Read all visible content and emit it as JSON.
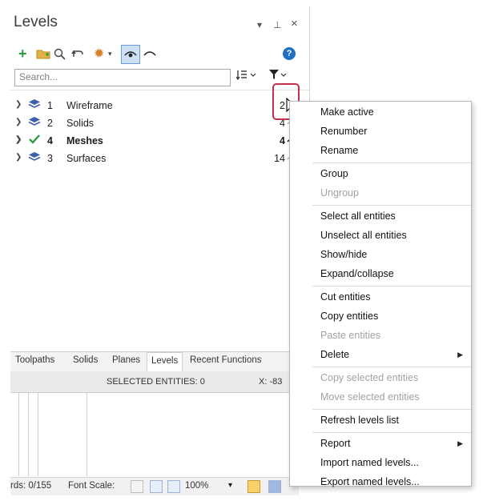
{
  "panel": {
    "title": "Levels",
    "controls": {
      "dropdown": "▾",
      "pin": "⊥",
      "close": "×"
    },
    "search_placeholder": "Search...",
    "help": "?"
  },
  "levels": [
    {
      "num": "1",
      "name": "Wireframe",
      "count": "2",
      "active": false,
      "color": "#3b5fa8"
    },
    {
      "num": "2",
      "name": "Solids",
      "count": "4",
      "active": false,
      "color": "#3b5fa8"
    },
    {
      "num": "4",
      "name": "Meshes",
      "count": "4",
      "active": true,
      "color": "#2d9b3e"
    },
    {
      "num": "3",
      "name": "Surfaces",
      "count": "14",
      "active": false,
      "color": "#3b5fa8"
    }
  ],
  "tabs": [
    "Toolpaths",
    "Solids",
    "Planes",
    "Levels",
    "Recent Functions"
  ],
  "status": {
    "selected": "SELECTED ENTITIES: 0",
    "x": "X:  -83"
  },
  "bottom": {
    "records": "rds: 0/155",
    "font_scale": "Font Scale:",
    "zoom": "100%"
  },
  "menu": [
    {
      "label": "Make active",
      "disabled": false
    },
    {
      "label": "Renumber",
      "disabled": false
    },
    {
      "label": "Rename",
      "disabled": false
    },
    {
      "sep": true
    },
    {
      "label": "Group",
      "disabled": false
    },
    {
      "label": "Ungroup",
      "disabled": true
    },
    {
      "sep": true
    },
    {
      "label": "Select all entities",
      "disabled": false
    },
    {
      "label": "Unselect all entities",
      "disabled": false
    },
    {
      "label": "Show/hide",
      "disabled": false
    },
    {
      "label": "Expand/collapse",
      "disabled": false
    },
    {
      "sep": true
    },
    {
      "label": "Cut entities",
      "disabled": false
    },
    {
      "label": "Copy entities",
      "disabled": false
    },
    {
      "label": "Paste entities",
      "disabled": true
    },
    {
      "label": "Delete",
      "disabled": false,
      "submenu": true
    },
    {
      "sep": true
    },
    {
      "label": "Copy selected entities",
      "disabled": true
    },
    {
      "label": "Move selected entities",
      "disabled": true
    },
    {
      "sep": true
    },
    {
      "label": "Refresh levels list",
      "disabled": false
    },
    {
      "sep": true
    },
    {
      "label": "Report",
      "disabled": false,
      "submenu": true
    },
    {
      "label": "Import named levels...",
      "disabled": false
    },
    {
      "label": "Export named levels...",
      "disabled": false
    }
  ],
  "colors": {
    "accent": "#c2304c",
    "add": "#2d9b3e",
    "help": "#1f6fc5",
    "level_icon": "#3b5fa8"
  },
  "icons": [
    "add-level-icon",
    "folder-add-icon",
    "search-icon",
    "undo-icon",
    "settings-gear-icon",
    "visibility-icon",
    "hide-icon",
    "help-icon",
    "sort-icon",
    "filter-icon",
    "more-options-icon"
  ]
}
